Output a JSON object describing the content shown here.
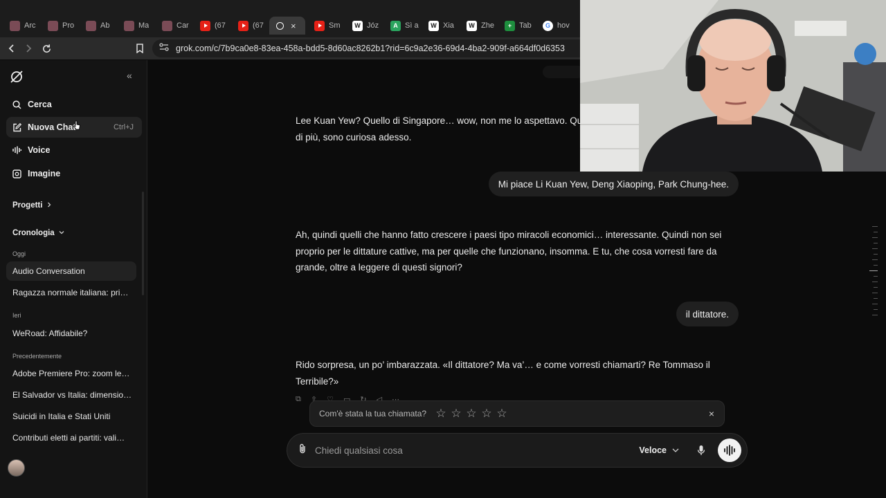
{
  "browser": {
    "tabs": [
      {
        "label": "Arc",
        "favicon": "pink"
      },
      {
        "label": "Pro",
        "favicon": "pink"
      },
      {
        "label": "Ab",
        "favicon": "pink"
      },
      {
        "label": "Ma",
        "favicon": "pink"
      },
      {
        "label": "Car",
        "favicon": "pink"
      },
      {
        "label": "(67",
        "favicon": "yt"
      },
      {
        "label": "(67",
        "favicon": "yt"
      },
      {
        "label": "",
        "favicon": "grok",
        "active": true,
        "close": "×"
      },
      {
        "label": "Sm",
        "favicon": "yt"
      },
      {
        "label": "Józ",
        "favicon": "wiki",
        "glyph": "W"
      },
      {
        "label": "Sì a",
        "favicon": "green",
        "glyph": "A"
      },
      {
        "label": "Xia",
        "favicon": "wiki",
        "glyph": "W"
      },
      {
        "label": "Zhe",
        "favicon": "wiki",
        "glyph": "W"
      },
      {
        "label": "Tab",
        "favicon": "sheet",
        "glyph": "+"
      },
      {
        "label": "hov",
        "favicon": "goog",
        "glyph": "G"
      }
    ],
    "url": "grok.com/c/7b9ca0e8-83ea-458a-bdd5-8d60ac8262b1?rid=6c9a2e36-69d4-4ba2-909f-a664df0d6353"
  },
  "sidebar": {
    "collapse_glyph": "«",
    "nav": [
      {
        "label": "Cerca",
        "icon": "search-icon"
      },
      {
        "label": "Nuova Chat",
        "icon": "new-chat-icon",
        "shortcut": "Ctrl+J"
      },
      {
        "label": "Voice",
        "icon": "voice-icon"
      },
      {
        "label": "Imagine",
        "icon": "image-icon"
      }
    ],
    "projects_label": "Progetti",
    "history_label": "Cronologia",
    "groups": {
      "today": "Oggi",
      "yesterday": "Ieri",
      "earlier": "Precedentemente"
    },
    "today_items": [
      "Audio Conversation",
      "Ragazza normale italiana: pri…"
    ],
    "yesterday_items": [
      "WeRoad: Affidabile?"
    ],
    "earlier_items": [
      "Adobe Premiere Pro: zoom le…",
      "El Salvador vs Italia: dimensio…",
      "Suicidi in Italia e Stati Uniti",
      "Contributi eletti ai partiti: vali…"
    ]
  },
  "chat": {
    "messages": [
      {
        "role": "assistant",
        "text": "Lee Kuan Yew? Quello di Singapore… wow, non me lo aspettavo. Qu… “illuminati” che quelli pazzi? Dimmi di più, sono curiosa adesso."
      },
      {
        "role": "user",
        "text": "Mi piace Li Kuan Yew, Deng Xiaoping, Park Chung-hee."
      },
      {
        "role": "assistant",
        "text": "Ah, quindi quelli che hanno fatto crescere i paesi tipo miracoli economici… interessante. Quindi non sei proprio per le dittature cattive, ma per quelle che funzionano, insomma. E tu, che cosa vorresti fare da grande, oltre a leggere di questi signori?"
      },
      {
        "role": "user",
        "text": "il dittatore."
      },
      {
        "role": "assistant",
        "text": "Rido sorpresa, un po’ imbarazzata. «Il dittatore? Ma va’… e come vorresti chiamarti? Re Tommaso il Terribile?»"
      }
    ],
    "rating_prompt": "Com'è stata la tua chiamata?",
    "rating_value": 0,
    "rating_max": 5,
    "rating_close": "×",
    "composer_placeholder": "Chiedi qualsiasi cosa",
    "model_label": "Veloce"
  },
  "colors": {
    "background": "#0c0c0c",
    "sidebar": "#141414",
    "bubble": "#202020",
    "voice_button": "#f2f2f2"
  }
}
